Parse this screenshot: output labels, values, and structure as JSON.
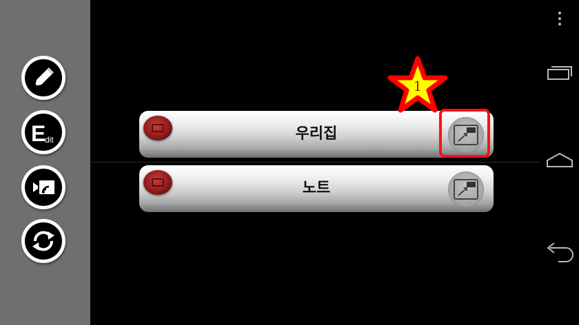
{
  "items": [
    {
      "label": "우리집"
    },
    {
      "label": "노트"
    }
  ],
  "annotation": {
    "number": "1"
  },
  "sidebar": {
    "buttons": [
      "pencil-icon",
      "edit-icon",
      "cast-icon",
      "sync-icon"
    ],
    "edit_icon_text": {
      "big": "E",
      "small": "dit"
    }
  },
  "colors": {
    "sidebar_bg": "#6f6f6f",
    "highlight": "#ff1010",
    "star_fill": "#ffff00",
    "star_stroke": "#ff0000"
  }
}
